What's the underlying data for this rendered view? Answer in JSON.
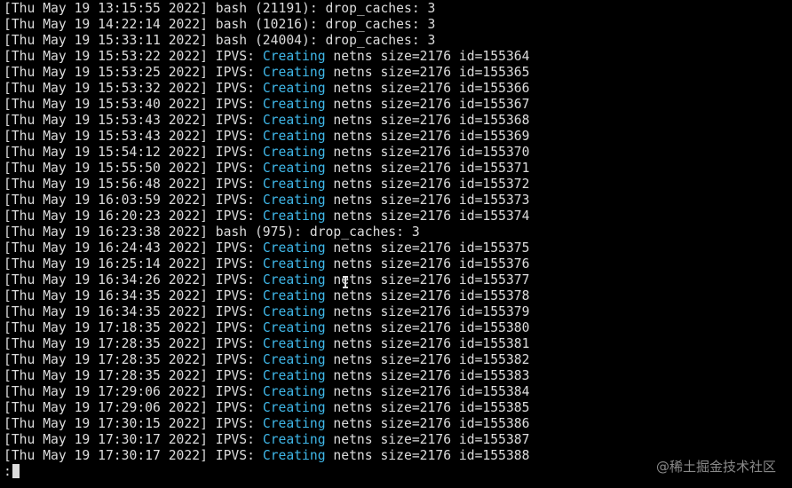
{
  "log_lines": [
    {
      "prefix": "[Thu May 19 13:15:55 2022] bash (21191): drop_caches: 3",
      "keyword": "",
      "suffix": ""
    },
    {
      "prefix": "[Thu May 19 14:22:14 2022] bash (10216): drop_caches: 3",
      "keyword": "",
      "suffix": ""
    },
    {
      "prefix": "[Thu May 19 15:33:11 2022] bash (24004): drop_caches: 3",
      "keyword": "",
      "suffix": ""
    },
    {
      "prefix": "[Thu May 19 15:53:22 2022] IPVS: ",
      "keyword": "Creating",
      "suffix": " netns size=2176 id=155364"
    },
    {
      "prefix": "[Thu May 19 15:53:25 2022] IPVS: ",
      "keyword": "Creating",
      "suffix": " netns size=2176 id=155365"
    },
    {
      "prefix": "[Thu May 19 15:53:32 2022] IPVS: ",
      "keyword": "Creating",
      "suffix": " netns size=2176 id=155366"
    },
    {
      "prefix": "[Thu May 19 15:53:40 2022] IPVS: ",
      "keyword": "Creating",
      "suffix": " netns size=2176 id=155367"
    },
    {
      "prefix": "[Thu May 19 15:53:43 2022] IPVS: ",
      "keyword": "Creating",
      "suffix": " netns size=2176 id=155368"
    },
    {
      "prefix": "[Thu May 19 15:53:43 2022] IPVS: ",
      "keyword": "Creating",
      "suffix": " netns size=2176 id=155369"
    },
    {
      "prefix": "[Thu May 19 15:54:12 2022] IPVS: ",
      "keyword": "Creating",
      "suffix": " netns size=2176 id=155370"
    },
    {
      "prefix": "[Thu May 19 15:55:50 2022] IPVS: ",
      "keyword": "Creating",
      "suffix": " netns size=2176 id=155371"
    },
    {
      "prefix": "[Thu May 19 15:56:48 2022] IPVS: ",
      "keyword": "Creating",
      "suffix": " netns size=2176 id=155372"
    },
    {
      "prefix": "[Thu May 19 16:03:59 2022] IPVS: ",
      "keyword": "Creating",
      "suffix": " netns size=2176 id=155373"
    },
    {
      "prefix": "[Thu May 19 16:20:23 2022] IPVS: ",
      "keyword": "Creating",
      "suffix": " netns size=2176 id=155374"
    },
    {
      "prefix": "[Thu May 19 16:23:38 2022] bash (975): drop_caches: 3",
      "keyword": "",
      "suffix": ""
    },
    {
      "prefix": "[Thu May 19 16:24:43 2022] IPVS: ",
      "keyword": "Creating",
      "suffix": " netns size=2176 id=155375"
    },
    {
      "prefix": "[Thu May 19 16:25:14 2022] IPVS: ",
      "keyword": "Creating",
      "suffix": " netns size=2176 id=155376"
    },
    {
      "prefix": "[Thu May 19 16:34:26 2022] IPVS: ",
      "keyword": "Creating",
      "suffix": " netns size=2176 id=155377"
    },
    {
      "prefix": "[Thu May 19 16:34:35 2022] IPVS: ",
      "keyword": "Creating",
      "suffix": " netns size=2176 id=155378"
    },
    {
      "prefix": "[Thu May 19 16:34:35 2022] IPVS: ",
      "keyword": "Creating",
      "suffix": " netns size=2176 id=155379"
    },
    {
      "prefix": "[Thu May 19 17:18:35 2022] IPVS: ",
      "keyword": "Creating",
      "suffix": " netns size=2176 id=155380"
    },
    {
      "prefix": "[Thu May 19 17:28:35 2022] IPVS: ",
      "keyword": "Creating",
      "suffix": " netns size=2176 id=155381"
    },
    {
      "prefix": "[Thu May 19 17:28:35 2022] IPVS: ",
      "keyword": "Creating",
      "suffix": " netns size=2176 id=155382"
    },
    {
      "prefix": "[Thu May 19 17:28:35 2022] IPVS: ",
      "keyword": "Creating",
      "suffix": " netns size=2176 id=155383"
    },
    {
      "prefix": "[Thu May 19 17:29:06 2022] IPVS: ",
      "keyword": "Creating",
      "suffix": " netns size=2176 id=155384"
    },
    {
      "prefix": "[Thu May 19 17:29:06 2022] IPVS: ",
      "keyword": "Creating",
      "suffix": " netns size=2176 id=155385"
    },
    {
      "prefix": "[Thu May 19 17:30:15 2022] IPVS: ",
      "keyword": "Creating",
      "suffix": " netns size=2176 id=155386"
    },
    {
      "prefix": "[Thu May 19 17:30:17 2022] IPVS: ",
      "keyword": "Creating",
      "suffix": " netns size=2176 id=155387"
    },
    {
      "prefix": "[Thu May 19 17:30:17 2022] IPVS: ",
      "keyword": "Creating",
      "suffix": " netns size=2176 id=155388"
    }
  ],
  "prompt": {
    "text": ":"
  },
  "watermark": {
    "text": "@稀土掘金技术社区"
  },
  "colors": {
    "background": "#000000",
    "foreground": "#dcdcdc",
    "highlight": "#3fb7e8"
  },
  "icons": {
    "mouse_pointer": "i-beam-cursor-icon",
    "text_cursor": "block-cursor-icon"
  }
}
